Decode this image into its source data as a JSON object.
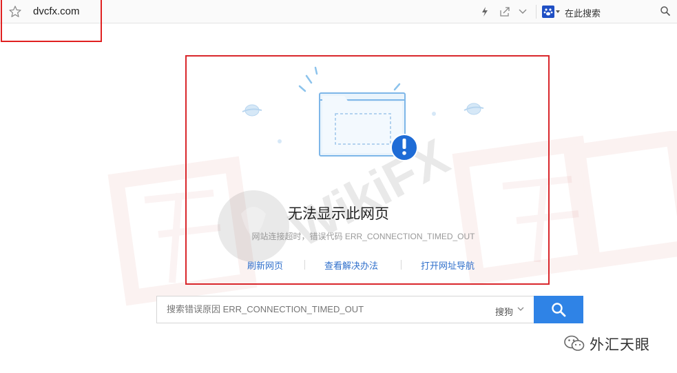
{
  "address_bar": {
    "url": "dvcfx.com",
    "search_placeholder": "在此搜索"
  },
  "error": {
    "title": "无法显示此网页",
    "subtitle": "网站连接超时，错误代码 ERR_CONNECTION_TIMED_OUT",
    "actions": [
      "刷新网页",
      "查看解决办法",
      "打开网址导航"
    ]
  },
  "search": {
    "placeholder": "搜索错误原因 ERR_CONNECTION_TIMED_OUT",
    "engine": "搜狗"
  },
  "watermark": {
    "brand": "WikiFX",
    "chinese": "外汇天眼"
  },
  "logo": {
    "text": "外汇天眼"
  },
  "colors": {
    "accent": "#2f83e6",
    "link": "#2f6fcb",
    "annotation_red": "#d9262b",
    "illustration": "#5aa0e0"
  }
}
